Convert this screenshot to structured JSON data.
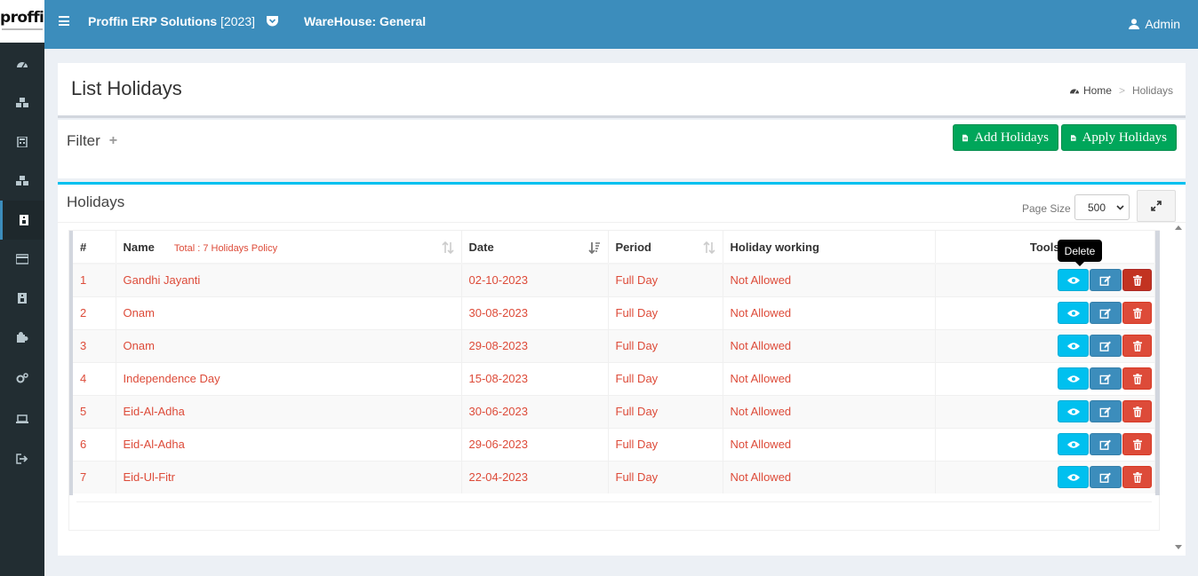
{
  "app": {
    "logo_text": "proffin",
    "brand": "Proffin ERP Solutions",
    "brand_year": "[2023]",
    "warehouse": "WareHouse: General",
    "user": "Admin"
  },
  "sidebar": {
    "items": [
      {
        "icon": "dashboard-icon"
      },
      {
        "icon": "cubes-icon"
      },
      {
        "icon": "calculator-icon"
      },
      {
        "icon": "cubes-icon"
      },
      {
        "icon": "id-card-icon",
        "active": true
      },
      {
        "icon": "credit-card-icon"
      },
      {
        "icon": "id-badge-icon"
      },
      {
        "icon": "puzzle-icon"
      },
      {
        "icon": "cogs-icon"
      },
      {
        "icon": "laptop-icon"
      },
      {
        "icon": "sign-out-icon"
      }
    ]
  },
  "page": {
    "title": "List Holidays",
    "breadcrumb": {
      "home": "Home",
      "separator": ">",
      "current": "Holidays"
    }
  },
  "filter": {
    "title": "Filter",
    "add_button": "Add Holidays",
    "apply_button": "Apply Holidays"
  },
  "holidays": {
    "title": "Holidays",
    "page_size_label": "Page Size",
    "page_size_value": "500",
    "columns": {
      "num": "#",
      "name": "Name",
      "total_label": "Total : 7 Holidays Policy",
      "date": "Date",
      "period": "Period",
      "holiday_working": "Holiday working",
      "tools": "Tools"
    },
    "tooltip": "Delete",
    "rows": [
      {
        "num": "1",
        "name": "Gandhi Jayanti",
        "date": "02-10-2023",
        "period": "Full Day",
        "working": "Not Allowed"
      },
      {
        "num": "2",
        "name": "Onam",
        "date": "30-08-2023",
        "period": "Full Day",
        "working": "Not Allowed"
      },
      {
        "num": "3",
        "name": "Onam",
        "date": "29-08-2023",
        "period": "Full Day",
        "working": "Not Allowed"
      },
      {
        "num": "4",
        "name": "Independence Day",
        "date": "15-08-2023",
        "period": "Full Day",
        "working": "Not Allowed"
      },
      {
        "num": "5",
        "name": "Eid-Al-Adha",
        "date": "30-06-2023",
        "period": "Full Day",
        "working": "Not Allowed"
      },
      {
        "num": "6",
        "name": "Eid-Al-Adha",
        "date": "29-06-2023",
        "period": "Full Day",
        "working": "Not Allowed"
      },
      {
        "num": "7",
        "name": "Eid-Ul-Fitr",
        "date": "22-04-2023",
        "period": "Full Day",
        "working": "Not Allowed"
      }
    ]
  },
  "colors": {
    "header": "#3c8dbc",
    "sidebar": "#222d32",
    "accent_green": "#00a65a",
    "accent_cyan": "#00c0ef",
    "danger": "#dd4b39"
  }
}
